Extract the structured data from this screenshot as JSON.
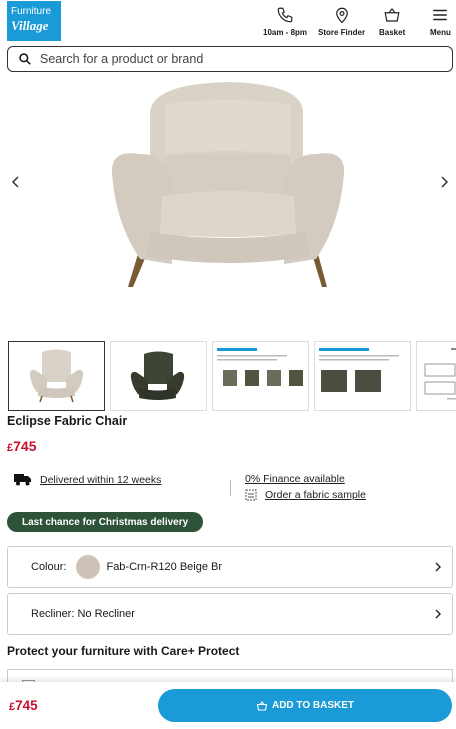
{
  "header": {
    "logo_line1": "Furniture",
    "logo_line2": "Village",
    "hours_label": "10am - 8pm",
    "store_finder_label": "Store Finder",
    "basket_label": "Basket",
    "menu_label": "Menu"
  },
  "search": {
    "placeholder": "Search for a product or brand"
  },
  "product": {
    "title": "Eclipse Fabric Chair",
    "currency": "£",
    "price": "745",
    "delivery_text": "Delivered within 12 weeks",
    "finance_text": "0% Finance available",
    "sample_text": "Order a fabric sample",
    "badge": "Last chance for Christmas delivery"
  },
  "options": {
    "colour_label": "Colour:",
    "colour_value": "Fab-Crn-R120 Beige Br",
    "recliner_text": "Recliner: No Recliner"
  },
  "care": {
    "heading": "Protect your furniture with Care+ Protect"
  },
  "bottom_bar": {
    "currency": "£",
    "price": "745",
    "add_label": "ADD TO BASKET"
  },
  "colors": {
    "accent": "#1a9ad6",
    "price_red": "#c8102e",
    "badge_green": "#2e5339",
    "fabric": "#d9d2c7"
  },
  "icons": [
    "phone-icon",
    "location-pin-icon",
    "basket-icon",
    "menu-icon",
    "search-icon",
    "truck-icon",
    "fabric-sample-icon",
    "chevron-right-icon",
    "chevron-left-icon"
  ]
}
